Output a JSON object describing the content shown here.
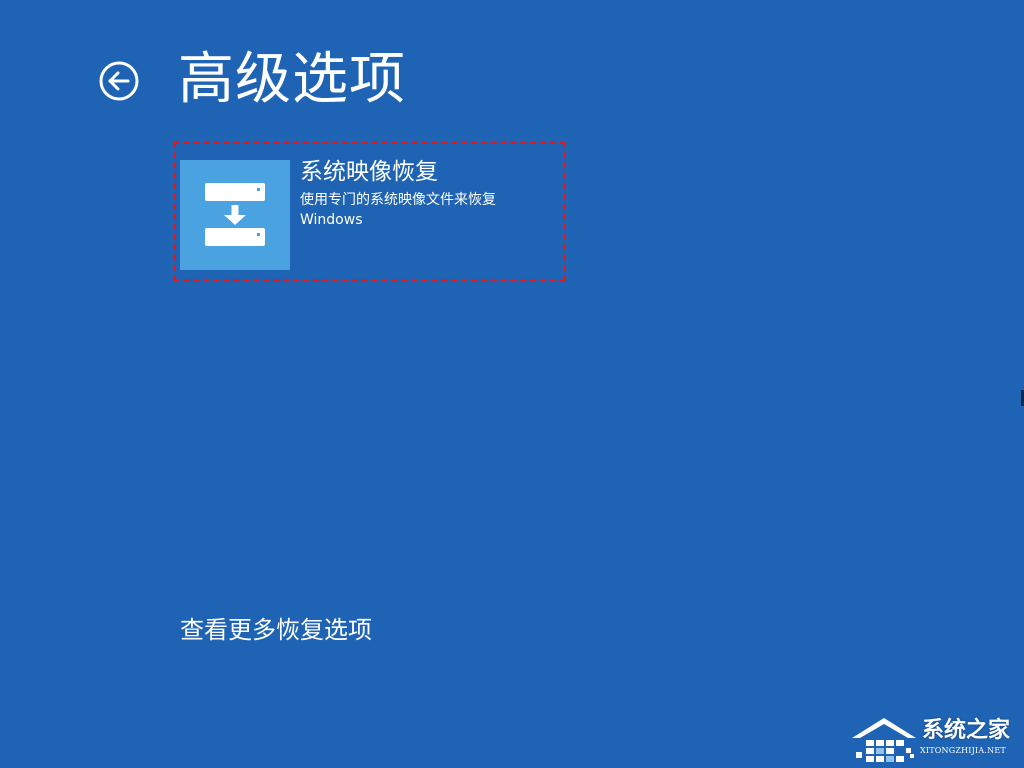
{
  "page": {
    "title": "高级选项",
    "background_color": "#1f64b4"
  },
  "back": {
    "icon": "back-arrow-icon"
  },
  "options": [
    {
      "title": "系统映像恢复",
      "description_line1": "使用专门的系统映像文件来恢复",
      "description_line2": "Windows",
      "icon": "system-image-restore-icon",
      "tile_color": "#4aa2e0",
      "highlight_color": "#e2191c"
    }
  ],
  "footer": {
    "more_options_label": "查看更多恢复选项"
  },
  "watermark": {
    "brand": "系统之家",
    "url": "XITONGZHIJIA.NET",
    "icon": "house-logo-icon"
  }
}
